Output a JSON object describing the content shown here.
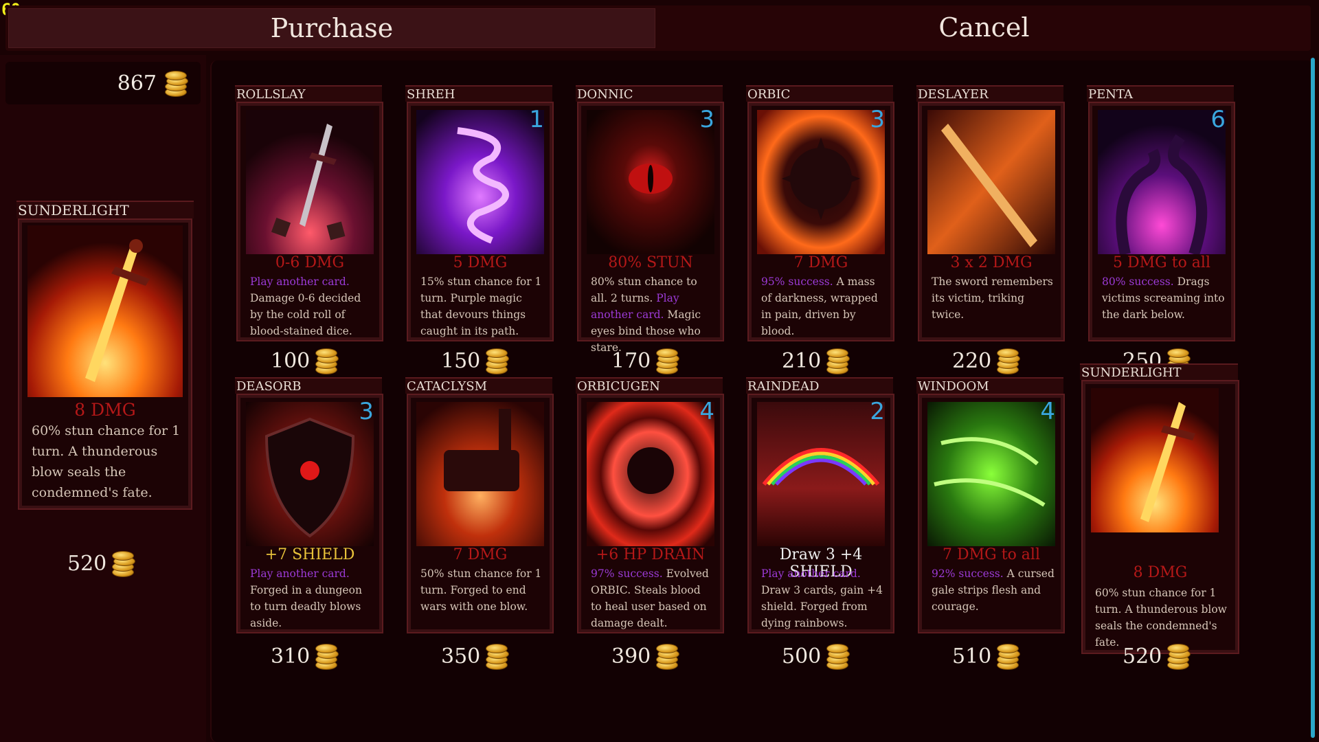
{
  "fps": "60",
  "top": {
    "purchase": "Purchase",
    "cancel": "Cancel"
  },
  "balance": "867",
  "selected": {
    "name": "SUNDERLIGHT",
    "title": "8 DMG",
    "desc": "60% stun chance for 1 turn. A thunderous blow seals the condemned's fate.",
    "price": "520"
  },
  "cards": [
    {
      "name": "ROLLSLAY",
      "badge": "",
      "title": "0-6 DMG",
      "purple": "Play another card.",
      "desc": "Damage 0-6 decided by the cold roll of blood-stained dice.",
      "price": "100",
      "art": "sword-dice"
    },
    {
      "name": "SHREH",
      "badge": "1",
      "title": "5 DMG",
      "purple": "",
      "desc": "15% stun chance for 1 turn. Purple magic that devours things caught in its path.",
      "price": "150",
      "art": "vortex"
    },
    {
      "name": "DONNIC",
      "badge": "3",
      "title": "80% STUN",
      "purple": "",
      "desc": "80% stun chance to all. 2 turns.",
      "desc_purple": "Play another card.",
      "desc_tail": "Magic eyes bind those who stare.",
      "price": "170",
      "art": "eye"
    },
    {
      "name": "ORBIC",
      "badge": "3",
      "title": "7 DMG",
      "purple": "95% success.",
      "desc": "A mass of darkness, wrapped in pain, driven by blood.",
      "price": "210",
      "art": "orb"
    },
    {
      "name": "DESLAYER",
      "badge": "",
      "title": "3 x 2 DMG",
      "purple": "",
      "desc": "The sword remembers its victim, triking twice.",
      "price": "220",
      "art": "blade"
    },
    {
      "name": "PENTA",
      "badge": "6",
      "title": "5 DMG to all",
      "purple": "80% success.",
      "desc": "Drags victims screaming into the dark below.",
      "price": "250",
      "art": "tentacles"
    },
    {
      "name": "DEASORB",
      "badge": "3",
      "title": "+7 SHIELD",
      "purple": "Play another card.",
      "desc": "Forged in a dungeon to turn deadly blows aside.",
      "price": "310",
      "art": "shield"
    },
    {
      "name": "CATACLYSM",
      "badge": "",
      "title": "7 DMG",
      "purple": "",
      "desc": "50% stun chance for 1 turn. Forged to end wars with one blow.",
      "price": "350",
      "art": "hammer"
    },
    {
      "name": "ORBICUGEN",
      "badge": "4",
      "title": "+6 HP DRAIN",
      "purple": "97% success.",
      "desc": "Evolved ORBIC. Steals blood to heal user based on damage dealt.",
      "price": "390",
      "art": "orb2"
    },
    {
      "name": "RAINDEAD",
      "badge": "2",
      "title": "Draw 3 +4 SHIELD",
      "purple": "Play another card.",
      "desc": "Draw 3 cards, gain +4 shield. Forged from dying rainbows.",
      "price": "500",
      "art": "rainbow"
    },
    {
      "name": "WINDOOM",
      "badge": "4",
      "title": "7 DMG to all",
      "purple": "92% success.",
      "desc": "A cursed gale strips flesh and courage.",
      "price": "510",
      "art": "wind"
    },
    {
      "name": "SUNDERLIGHT",
      "badge": "",
      "title": "8 DMG",
      "purple": "",
      "desc": "60% stun chance for 1 turn. A thunderous blow seals the condemned's fate.",
      "price": "520",
      "art": "firesword"
    }
  ]
}
